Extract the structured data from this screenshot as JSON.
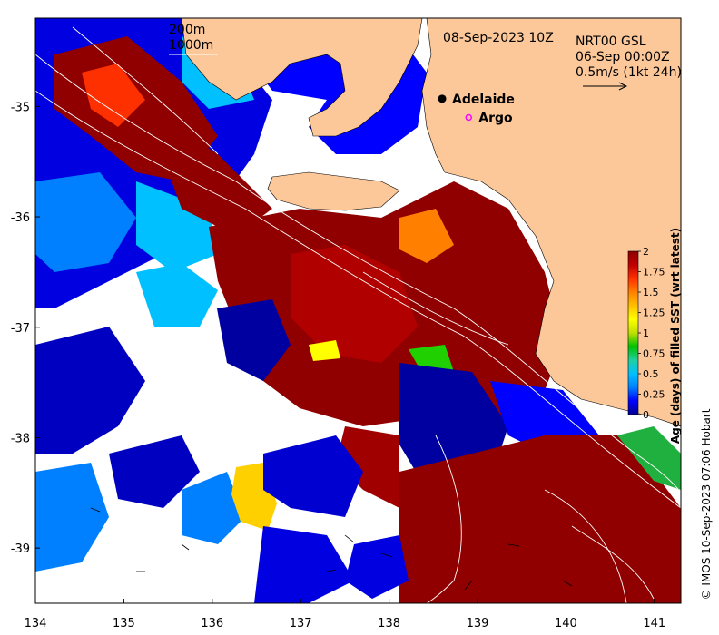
{
  "map": {
    "date_label": "08-Sep-2023 10Z",
    "legend": {
      "contour_200": "200m",
      "contour_1000": "1000m"
    },
    "current_info": {
      "line1": "NRT00 GSL",
      "line2": "06-Sep 00:00Z",
      "line3": "0.5m/s (1kt 24h)"
    },
    "places": [
      {
        "name": "Adelaide",
        "lon": 138.6,
        "lat": -34.93,
        "marker": "filled-dot",
        "color": "#000000"
      },
      {
        "name": "Argo",
        "lon": 138.9,
        "lat": -35.1,
        "marker": "open-circle",
        "color": "#ff00ff"
      }
    ],
    "credit": "© IMOS 10-Sep-2023 07:06 Hobart",
    "land_color": "#fcc89a",
    "extent": {
      "lon": [
        134,
        141.3
      ],
      "lat": [
        -39.5,
        -34.2
      ]
    }
  },
  "axes": {
    "x_ticks": [
      134,
      135,
      136,
      137,
      138,
      139,
      140,
      141
    ],
    "y_ticks": [
      -35,
      -36,
      -37,
      -38,
      -39
    ]
  },
  "colorbar": {
    "title": "Age (days) of filled SST (wrt latest)",
    "ticks": [
      "0",
      "0.25",
      "0.5",
      "0.75",
      "1",
      "1.25",
      "1.5",
      "1.75",
      "2"
    ],
    "range": [
      0,
      2
    ],
    "colors": [
      "#00008f",
      "#0000ff",
      "#0080ff",
      "#00c0ff",
      "#20d0a0",
      "#00c000",
      "#c0e000",
      "#ffff00",
      "#ffc000",
      "#ff8000",
      "#ff3000",
      "#c00000",
      "#900000"
    ]
  }
}
